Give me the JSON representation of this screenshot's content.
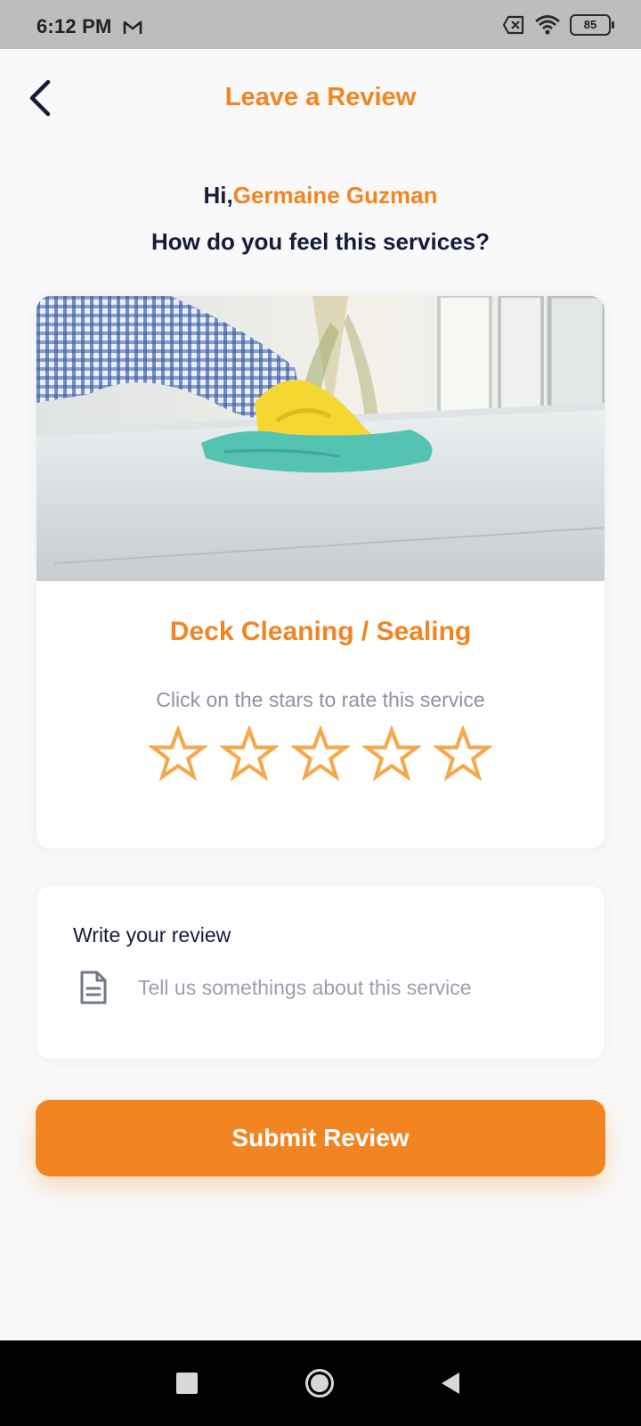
{
  "status_bar": {
    "time": "6:12 PM",
    "notification_icon": "gmail-icon",
    "battery_level": "85",
    "icons": [
      "sim-disabled-icon",
      "wifi-icon",
      "battery-icon"
    ]
  },
  "header": {
    "title": "Leave a Review",
    "back_icon": "chevron-left-icon"
  },
  "greeting": {
    "prefix": "Hi,",
    "user_name": "Germaine Guzman",
    "question": "How do you feel this services?"
  },
  "service": {
    "image": "cleaning-photo",
    "name": "Deck Cleaning / Sealing",
    "rate_hint": "Click on the stars to rate this service",
    "rating": 0,
    "max_rating": 5
  },
  "review": {
    "label": "Write your review",
    "placeholder": "Tell us somethings about this service",
    "value": "",
    "icon": "document-icon"
  },
  "submit": {
    "label": "Submit Review"
  },
  "nav_bar": {
    "buttons": [
      "recents-button",
      "home-button",
      "back-button"
    ]
  },
  "colors": {
    "accent": "#f28522",
    "heading": "#141b3d",
    "muted_text": "#8d93a5",
    "star_outline": "#f5a94c",
    "background": "#f9f9f9",
    "status_bar": "#bdbdbd"
  }
}
